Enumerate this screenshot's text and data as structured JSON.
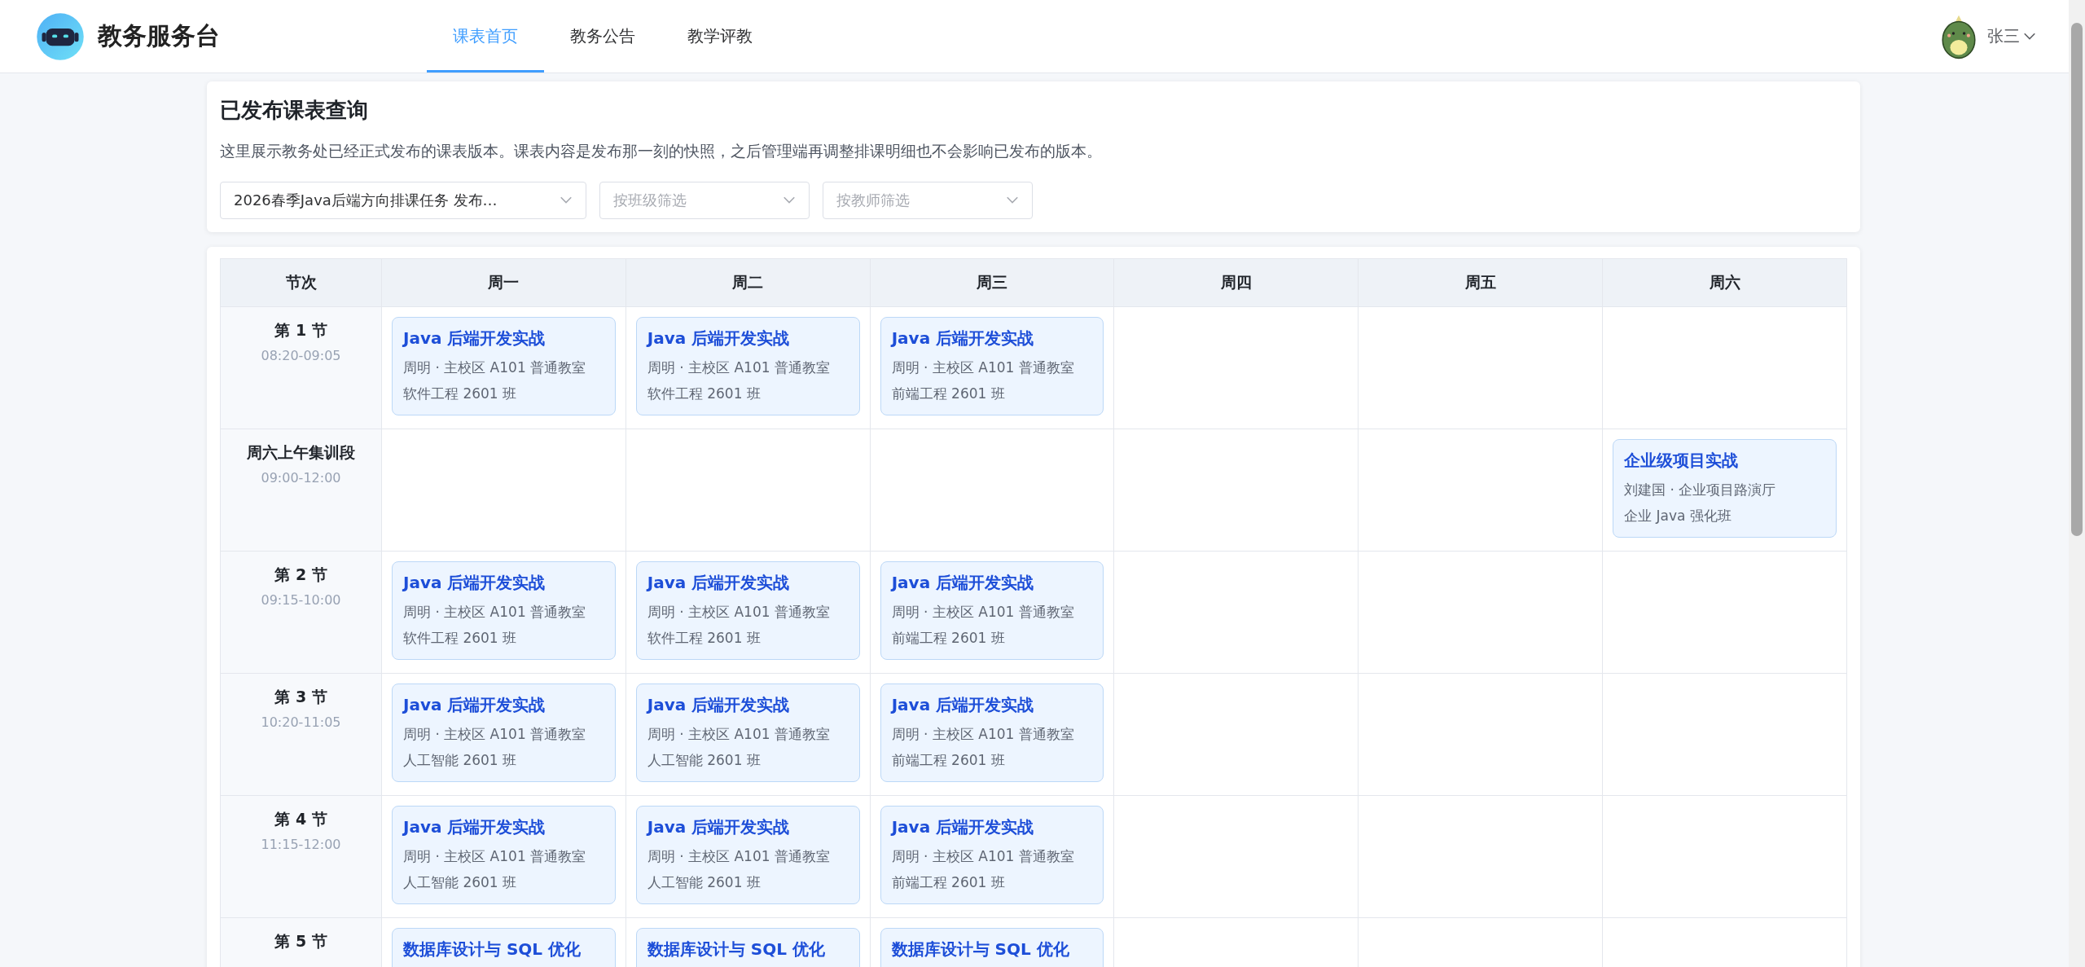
{
  "header": {
    "app_name": "教务服务台",
    "nav": [
      {
        "label": "课表首页",
        "selected": true
      },
      {
        "label": "教务公告",
        "selected": false
      },
      {
        "label": "教学评教",
        "selected": false
      }
    ],
    "user": {
      "name": "张三"
    }
  },
  "query": {
    "title": "已发布课表查询",
    "description": "这里展示教务处已经正式发布的课表版本。课表内容是发布那一刻的快照，之后管理端再调整排课明细也不会影响已发布的版本。",
    "filters": [
      {
        "value": "2026春季Java后端方向排课任务 发布…"
      },
      {
        "placeholder": "按班级筛选"
      },
      {
        "placeholder": "按教师筛选"
      }
    ]
  },
  "timetable": {
    "period_header": "节次",
    "columns": [
      "周一",
      "周二",
      "周三",
      "周四",
      "周五",
      "周六"
    ],
    "rows": [
      {
        "label": "第 1 节",
        "time": "08:20-09:05",
        "cells": [
          {
            "course": "Java 后端开发实战",
            "detail": "周明 · 主校区 A101 普通教室",
            "class": "软件工程 2601 班"
          },
          {
            "course": "Java 后端开发实战",
            "detail": "周明 · 主校区 A101 普通教室",
            "class": "软件工程 2601 班"
          },
          {
            "course": "Java 后端开发实战",
            "detail": "周明 · 主校区 A101 普通教室",
            "class": "前端工程 2601 班"
          },
          {},
          {},
          {}
        ]
      },
      {
        "label": "周六上午集训段",
        "time": "09:00-12:00",
        "cells": [
          {},
          {},
          {},
          {},
          {},
          {
            "course": "企业级项目实战",
            "detail": "刘建国 · 企业项目路演厅",
            "class": "企业 Java 强化班"
          }
        ]
      },
      {
        "label": "第 2 节",
        "time": "09:15-10:00",
        "cells": [
          {
            "course": "Java 后端开发实战",
            "detail": "周明 · 主校区 A101 普通教室",
            "class": "软件工程 2601 班"
          },
          {
            "course": "Java 后端开发实战",
            "detail": "周明 · 主校区 A101 普通教室",
            "class": "软件工程 2601 班"
          },
          {
            "course": "Java 后端开发实战",
            "detail": "周明 · 主校区 A101 普通教室",
            "class": "前端工程 2601 班"
          },
          {},
          {},
          {}
        ]
      },
      {
        "label": "第 3 节",
        "time": "10:20-11:05",
        "cells": [
          {
            "course": "Java 后端开发实战",
            "detail": "周明 · 主校区 A101 普通教室",
            "class": "人工智能 2601 班"
          },
          {
            "course": "Java 后端开发实战",
            "detail": "周明 · 主校区 A101 普通教室",
            "class": "人工智能 2601 班"
          },
          {
            "course": "Java 后端开发实战",
            "detail": "周明 · 主校区 A101 普通教室",
            "class": "前端工程 2601 班"
          },
          {},
          {},
          {}
        ]
      },
      {
        "label": "第 4 节",
        "time": "11:15-12:00",
        "cells": [
          {
            "course": "Java 后端开发实战",
            "detail": "周明 · 主校区 A101 普通教室",
            "class": "人工智能 2601 班"
          },
          {
            "course": "Java 后端开发实战",
            "detail": "周明 · 主校区 A101 普通教室",
            "class": "人工智能 2601 班"
          },
          {
            "course": "Java 后端开发实战",
            "detail": "周明 · 主校区 A101 普通教室",
            "class": "前端工程 2601 班"
          },
          {},
          {},
          {}
        ]
      },
      {
        "label": "第 5 节",
        "cells": [
          {
            "course": "数据库设计与 SQL 优化"
          },
          {
            "course": "数据库设计与 SQL 优化"
          },
          {
            "course": "数据库设计与 SQL 优化"
          },
          {},
          {},
          {}
        ]
      }
    ]
  }
}
